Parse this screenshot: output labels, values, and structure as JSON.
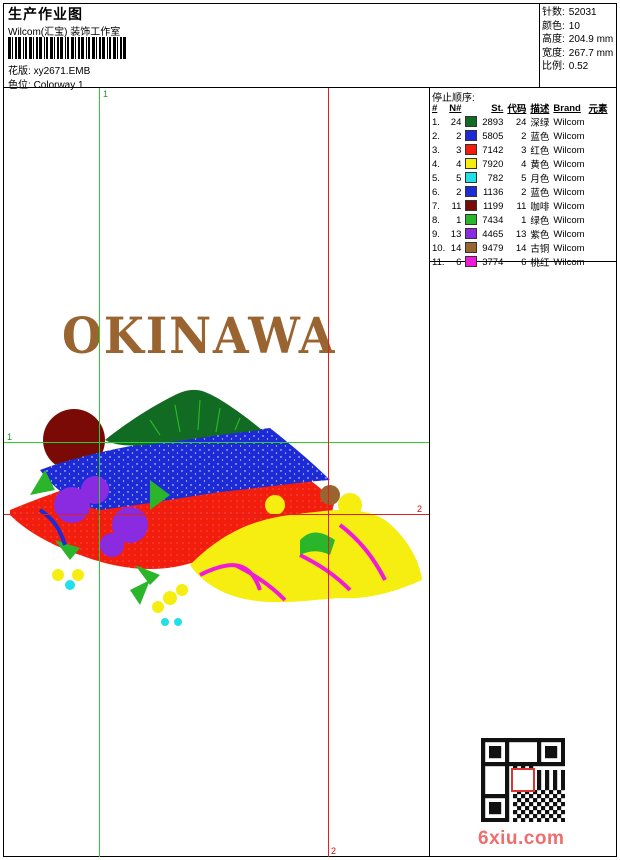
{
  "header": {
    "title": "生产作业图",
    "company": "Wilcom(汇宝) 装饰工作室",
    "design_label": "花版:",
    "design_file": "xy2671.EMB",
    "colorway_label": "色位:",
    "colorway": "Colorway 1"
  },
  "stats": [
    {
      "label": "针数:",
      "value": "52031"
    },
    {
      "label": "颜色:",
      "value": "10"
    },
    {
      "label": "高度:",
      "value": "204.9 mm"
    },
    {
      "label": "宽度:",
      "value": "267.7 mm"
    },
    {
      "label": "比例:",
      "value": "0.52"
    }
  ],
  "stop_sequence": {
    "title": "停止顺序:",
    "columns": [
      "#",
      "N#",
      "St.",
      "代码",
      "描述",
      "Brand",
      "元素"
    ],
    "rows": [
      {
        "idx": "1.",
        "n": "24",
        "color": "#116b22",
        "st": "2893",
        "code": "24",
        "desc": "深绿",
        "brand": "Wilcom"
      },
      {
        "idx": "2.",
        "n": "2",
        "color": "#1c2bd6",
        "st": "5805",
        "code": "2",
        "desc": "蓝色",
        "brand": "Wilcom"
      },
      {
        "idx": "3.",
        "n": "3",
        "color": "#f21d0d",
        "st": "7142",
        "code": "3",
        "desc": "红色",
        "brand": "Wilcom"
      },
      {
        "idx": "4.",
        "n": "4",
        "color": "#f6ee10",
        "st": "7920",
        "code": "4",
        "desc": "黄色",
        "brand": "Wilcom"
      },
      {
        "idx": "5.",
        "n": "5",
        "color": "#22e0e8",
        "st": "782",
        "code": "5",
        "desc": "月色",
        "brand": "Wilcom"
      },
      {
        "idx": "6.",
        "n": "2",
        "color": "#1c2bd6",
        "st": "1136",
        "code": "2",
        "desc": "蓝色",
        "brand": "Wilcom"
      },
      {
        "idx": "7.",
        "n": "11",
        "color": "#7a0a06",
        "st": "1199",
        "code": "11",
        "desc": "咖啡",
        "brand": "Wilcom"
      },
      {
        "idx": "8.",
        "n": "1",
        "color": "#2ab52a",
        "st": "7434",
        "code": "1",
        "desc": "绿色",
        "brand": "Wilcom"
      },
      {
        "idx": "9.",
        "n": "13",
        "color": "#8a2be2",
        "st": "4465",
        "code": "13",
        "desc": "紫色",
        "brand": "Wilcom"
      },
      {
        "idx": "10.",
        "n": "14",
        "color": "#9a6430",
        "st": "9479",
        "code": "14",
        "desc": "古铜",
        "brand": "Wilcom"
      },
      {
        "idx": "11.",
        "n": "6",
        "color": "#f01bd8",
        "st": "3774",
        "code": "6",
        "desc": "桃红",
        "brand": "Wilcom"
      }
    ]
  },
  "canvas": {
    "design_text": "OKINAWA",
    "guide_labels": {
      "v1": "1",
      "h1": "1",
      "h2": "2",
      "v2": "2"
    }
  },
  "watermark": "6xiu.com",
  "icons": {
    "barcode": "barcode-icon",
    "qr": "qr-code-icon"
  }
}
